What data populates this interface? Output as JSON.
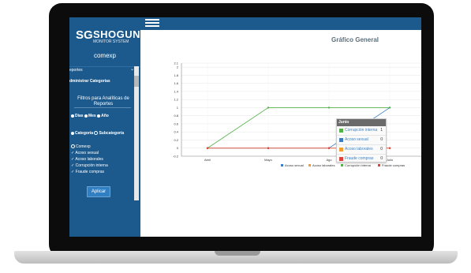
{
  "app": {
    "logo_mark": "SG",
    "logo_text": "SHOGUN",
    "logo_subtitle": "MONITOR SYSTEM",
    "company": "comexp"
  },
  "sidebar": {
    "menu_label": "eportes",
    "menu_item": "dministrar Categorias",
    "filters_title": "Filtros para Analíticas de Reportes",
    "period_options": [
      "Dias",
      "Mes",
      "Año"
    ],
    "group_options": [
      "Categoría",
      "Subcategoría"
    ],
    "company_item": "Comexp",
    "categories": [
      "Acoso sexual",
      "Acoso laborales",
      "Corrupción interna",
      "Fraude compras"
    ],
    "apply_label": "Aplicar"
  },
  "chart_data": {
    "type": "line",
    "title": "Gráfico General",
    "categories": [
      "Abril",
      "Mayo",
      "Junio",
      "Julio"
    ],
    "tick_labels": [
      "Abril",
      "Mayo",
      "Ago",
      "Julio"
    ],
    "ylim": [
      -0.2,
      2.1
    ],
    "yticks": [
      "2.1",
      "2",
      "1.8",
      "1.6",
      "1.4",
      "1.2",
      "1",
      "0.8",
      "0.6",
      "0.4",
      "0.2",
      "0",
      "-0.2"
    ],
    "grid": true,
    "legend_position": "bottom",
    "series": [
      {
        "name": "Acoso sexual",
        "color": "#3b7dc4",
        "values": [
          0,
          0,
          0,
          1
        ]
      },
      {
        "name": "Acoso laborales",
        "color": "#f29b2f",
        "values": [
          0,
          0,
          0,
          0
        ]
      },
      {
        "name": "Corrupción interna",
        "color": "#55b24a",
        "values": [
          0,
          1,
          1,
          1
        ]
      },
      {
        "name": "Fraude compras",
        "color": "#e0413a",
        "values": [
          0,
          0,
          0,
          0
        ]
      }
    ]
  },
  "tooltip": {
    "title": "Junio",
    "rows": [
      {
        "label": "Corrupción interna",
        "value": "1",
        "color": "#55b24a"
      },
      {
        "label": "Acoso sexual",
        "value": "0",
        "color": "#3b7dc4"
      },
      {
        "label": "Acoso laborales",
        "value": "0",
        "color": "#f29b2f"
      },
      {
        "label": "Fraude compras",
        "value": "0",
        "color": "#e0413a"
      }
    ]
  }
}
